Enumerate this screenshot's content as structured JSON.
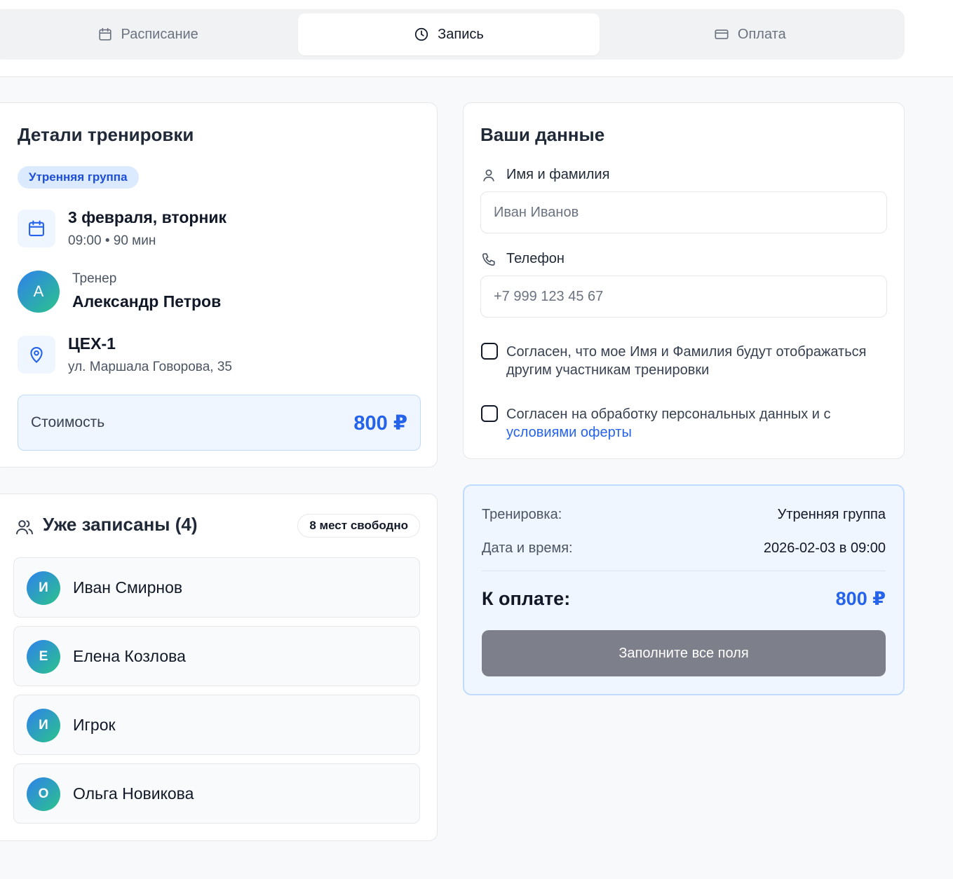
{
  "tabs": [
    {
      "label": "Расписание",
      "icon": "calendar-icon"
    },
    {
      "label": "Запись",
      "icon": "clock-icon"
    },
    {
      "label": "Оплата",
      "icon": "credit-card-icon"
    }
  ],
  "details": {
    "title": "Детали тренировки",
    "group_badge": "Утренняя группа",
    "date": "3 февраля, вторник",
    "time": "09:00 • 90 мин",
    "trainer_label": "Тренер",
    "trainer_name": "Александр Петров",
    "trainer_initial": "А",
    "location_name": "ЦЕХ-1",
    "location_address": "ул. Маршала Говорова, 35",
    "price_label": "Стоимость",
    "price_value": "800 ₽"
  },
  "form": {
    "title": "Ваши данные",
    "name_label": "Имя и фамилия",
    "name_placeholder": "Иван Иванов",
    "phone_label": "Телефон",
    "phone_placeholder": "+7 999 123 45 67",
    "consent_display": "Согласен, что мое Имя и Фамилия будут отображаться другим участникам тренировки",
    "consent_data": "Согласен на обработку персональных данных и с",
    "consent_link": "условиями оферты"
  },
  "signed": {
    "title": "Уже записаны (4)",
    "free_badge": "8 мест свободно",
    "participants": [
      {
        "initial": "И",
        "name": "Иван Смирнов"
      },
      {
        "initial": "Е",
        "name": "Елена Козлова"
      },
      {
        "initial": "И",
        "name": "Игрок"
      },
      {
        "initial": "О",
        "name": "Ольга Новикова"
      }
    ]
  },
  "summary": {
    "training_label": "Тренировка:",
    "training_value": "Утренняя группа",
    "datetime_label": "Дата и время:",
    "datetime_value": "2026-02-03 в 09:00",
    "total_label": "К оплате:",
    "total_value": "800 ₽",
    "submit_label": "Заполните все поля"
  },
  "colors": {
    "accent": "#2563eb",
    "accent_light": "#eff6ff",
    "button_disabled": "#7d7f8a"
  }
}
